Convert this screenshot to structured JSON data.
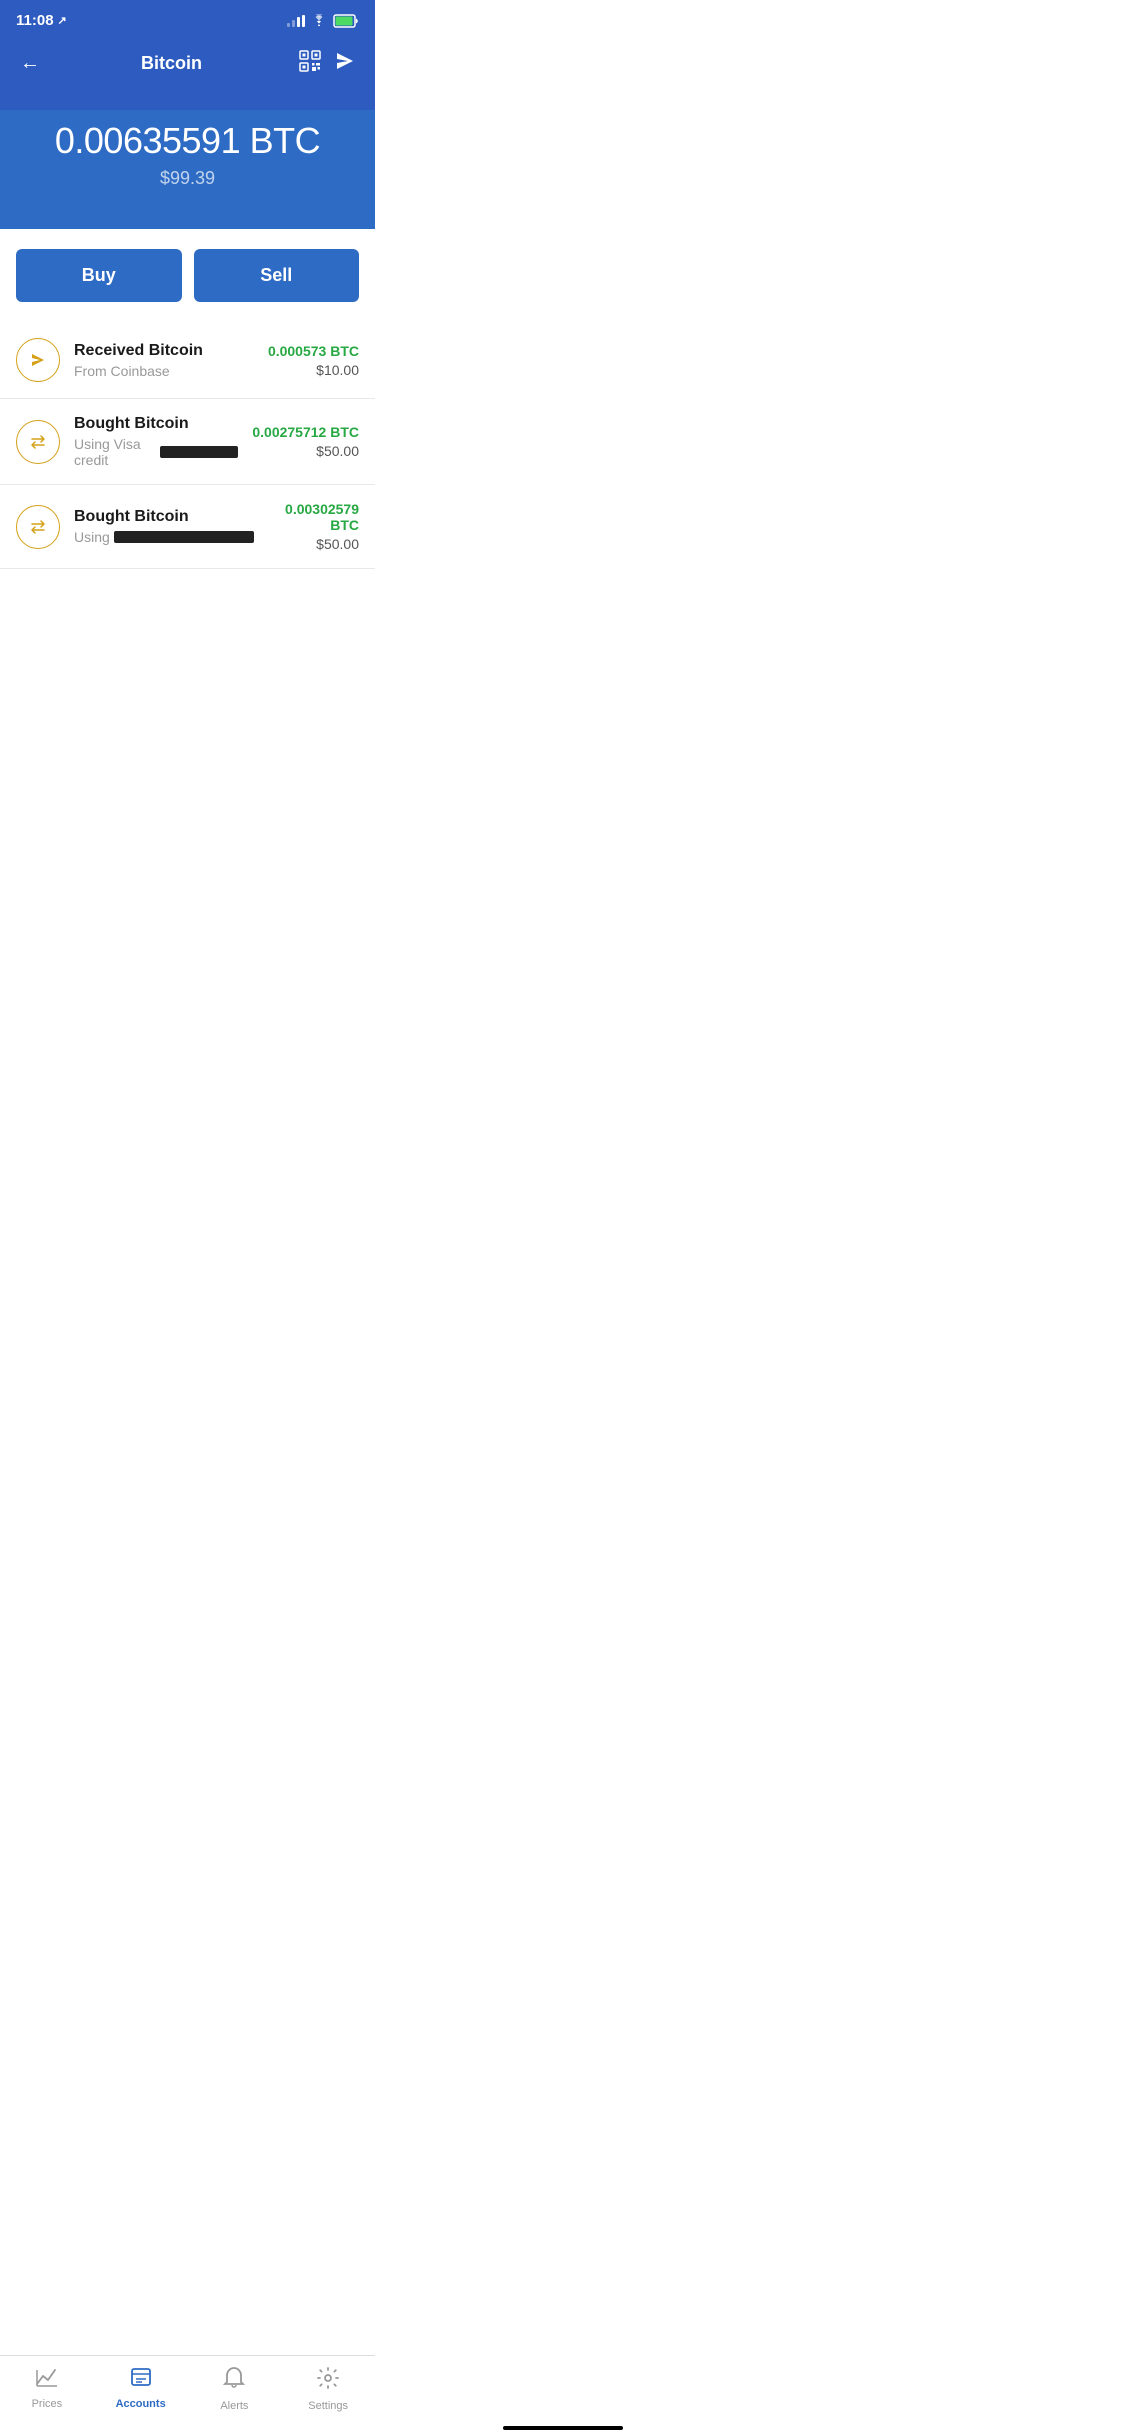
{
  "statusBar": {
    "time": "11:08",
    "locationIcon": "↗"
  },
  "header": {
    "backLabel": "←",
    "title": "Bitcoin",
    "sendLabel": "✈"
  },
  "balance": {
    "btc": "0.00635591 BTC",
    "usd": "$99.39"
  },
  "actions": {
    "buyLabel": "Buy",
    "sellLabel": "Sell"
  },
  "transactions": [
    {
      "type": "receive",
      "title": "Received Bitcoin",
      "subtitle": "From Coinbase",
      "btcAmount": "0.000573 BTC",
      "usdAmount": "$10.00",
      "redacted": false
    },
    {
      "type": "exchange",
      "title": "Bought Bitcoin",
      "subtitle": "Using Visa credit",
      "btcAmount": "0.00275712 BTC",
      "usdAmount": "$50.00",
      "redacted": true
    },
    {
      "type": "exchange",
      "title": "Bought Bitcoin",
      "subtitle": "Using",
      "btcAmount": "0.00302579 BTC",
      "usdAmount": "$50.00",
      "redacted": true
    }
  ],
  "bottomNav": [
    {
      "id": "prices",
      "label": "Prices",
      "active": false
    },
    {
      "id": "accounts",
      "label": "Accounts",
      "active": true
    },
    {
      "id": "alerts",
      "label": "Alerts",
      "active": false
    },
    {
      "id": "settings",
      "label": "Settings",
      "active": false
    }
  ]
}
